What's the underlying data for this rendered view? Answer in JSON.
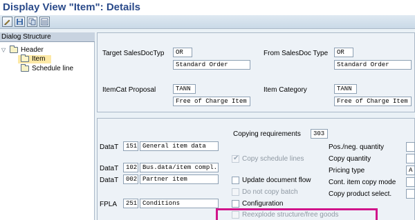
{
  "window": {
    "title": "Display View \"Item\": Details"
  },
  "toolbar": {
    "icons": [
      "edit-icon",
      "save-icon",
      "copy-icon",
      "overview-icon"
    ]
  },
  "dialog_structure": {
    "header": "Dialog Structure",
    "items": [
      {
        "label": "Header",
        "expanded": true,
        "selected": false,
        "level": 0
      },
      {
        "label": "Item",
        "selected": true,
        "level": 1
      },
      {
        "label": "Schedule line",
        "selected": false,
        "level": 1
      }
    ]
  },
  "top_panel": {
    "target_salesdoc_label": "Target SalesDocTyp",
    "target_salesdoc_code": "OR",
    "target_salesdoc_desc": "Standard Order",
    "from_salesdoc_label": "From SalesDoc Type",
    "from_salesdoc_code": "OR",
    "from_salesdoc_desc": "Standard Order",
    "itemcat_proposal_label": "ItemCat Proposal",
    "itemcat_proposal_code": "TANN",
    "itemcat_proposal_desc": "Free of Charge Item",
    "item_category_label": "Item Category",
    "item_category_code": "TANN",
    "item_category_desc": "Free of Charge Item"
  },
  "bottom_panel": {
    "copying_requirements_label": "Copying requirements",
    "copying_requirements_value": "303",
    "data_rows": [
      {
        "label": "DataT",
        "num": "151",
        "desc": "General item data"
      },
      {
        "label": "DataT",
        "num": "102",
        "desc": "Bus.data/item compl."
      },
      {
        "label": "DataT",
        "num": "002",
        "desc": "Partner item"
      },
      {
        "label": "FPLA",
        "num": "251",
        "desc": "Conditions"
      }
    ],
    "copy_schedule_lines": {
      "label": "Copy schedule lines",
      "checked": true,
      "disabled": true
    },
    "update_document_flow": {
      "label": "Update document flow",
      "checked": false
    },
    "do_not_copy_batch": {
      "label": "Do not copy batch",
      "checked": false,
      "disabled": true
    },
    "configuration": {
      "label": "Configuration",
      "checked": false
    },
    "reexplode": {
      "label": "Reexplode structure/free goods",
      "checked": false,
      "disabled": true
    },
    "right_fields": [
      {
        "label": "Pos./neg. quantity",
        "value": ""
      },
      {
        "label": "Copy quantity",
        "value": ""
      },
      {
        "label": "Pricing type",
        "value": "A"
      },
      {
        "label": "Cont. item copy mode",
        "value": ""
      },
      {
        "label": "Copy product select.",
        "value": ""
      }
    ]
  }
}
